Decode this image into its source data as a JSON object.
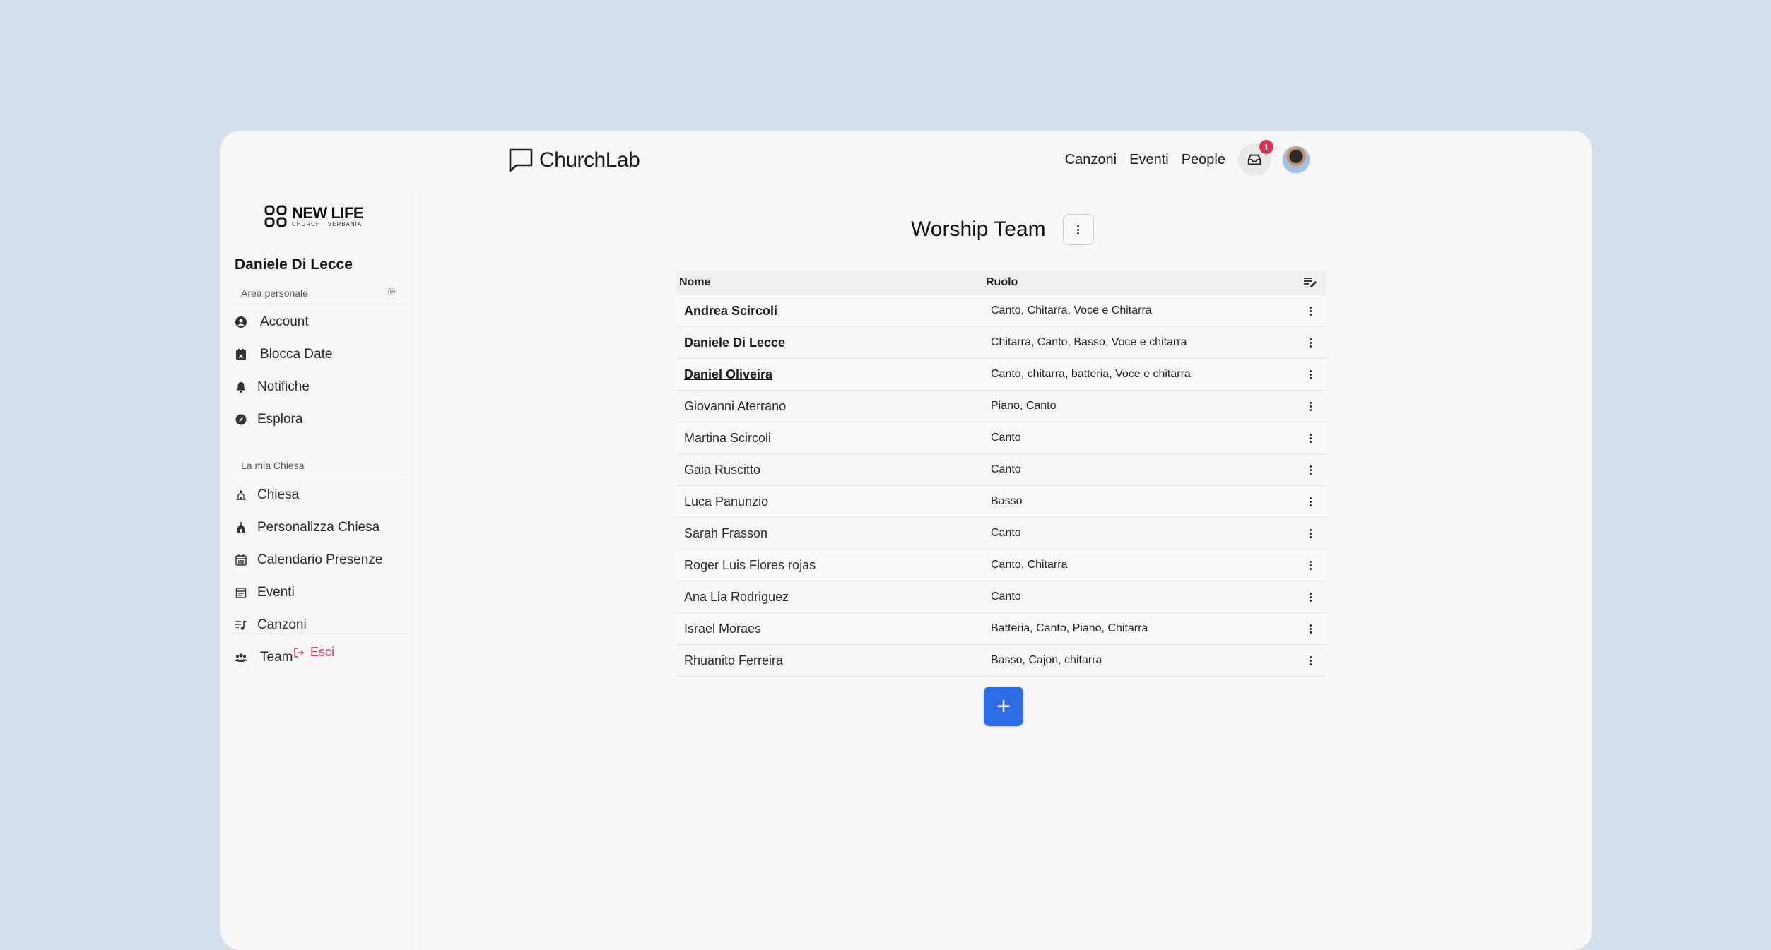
{
  "app": {
    "name": "ChurchLab"
  },
  "topnav": {
    "links": [
      "Canzoni",
      "Eventi",
      "People"
    ],
    "notification_count": "1"
  },
  "sidebar": {
    "church": {
      "line1": "NEW LIFE",
      "line2": "CHURCH · VERBANIA"
    },
    "user_name": "Daniele Di Lecce",
    "personal_section": "Area personale",
    "personal_items": [
      "Account",
      "Blocca Date",
      "Notifiche",
      "Esplora"
    ],
    "church_section": "La mia Chiesa",
    "church_items": [
      "Chiesa",
      "Personalizza Chiesa",
      "Calendario Presenze",
      "Eventi",
      "Canzoni",
      "Team"
    ],
    "logout": "Esci"
  },
  "page": {
    "title": "Worship Team"
  },
  "table": {
    "headers": {
      "name": "Nome",
      "role": "Ruolo"
    },
    "rows": [
      {
        "name": "Andrea Scircoli",
        "role": "Canto, Chitarra, Voce e Chitarra",
        "linked": true
      },
      {
        "name": "Daniele Di Lecce",
        "role": "Chitarra, Canto, Basso, Voce e chitarra",
        "linked": true
      },
      {
        "name": "Daniel Oliveira",
        "role": "Canto, chitarra, batteria, Voce e chitarra",
        "linked": true
      },
      {
        "name": "Giovanni Aterrano",
        "role": "Piano, Canto",
        "linked": false
      },
      {
        "name": "Martina Scircoli",
        "role": "Canto",
        "linked": false
      },
      {
        "name": "Gaia Ruscitto",
        "role": "Canto",
        "linked": false
      },
      {
        "name": "Luca Panunzio",
        "role": "Basso",
        "linked": false
      },
      {
        "name": "Sarah Frasson",
        "role": "Canto",
        "linked": false
      },
      {
        "name": "Roger Luis Flores rojas",
        "role": "Canto, Chitarra",
        "linked": false
      },
      {
        "name": "Ana Lia Rodriguez",
        "role": "Canto",
        "linked": false
      },
      {
        "name": "Israel Moraes",
        "role": "Batteria, Canto, Piano, Chitarra",
        "linked": false
      },
      {
        "name": "Rhuanito Ferreira",
        "role": "Basso, Cajon, chitarra",
        "linked": false
      }
    ]
  },
  "add_button": {
    "label": "+"
  },
  "colors": {
    "background": "#d3e0ec",
    "accent": "#2d6ee6",
    "danger": "#d43a5c"
  }
}
